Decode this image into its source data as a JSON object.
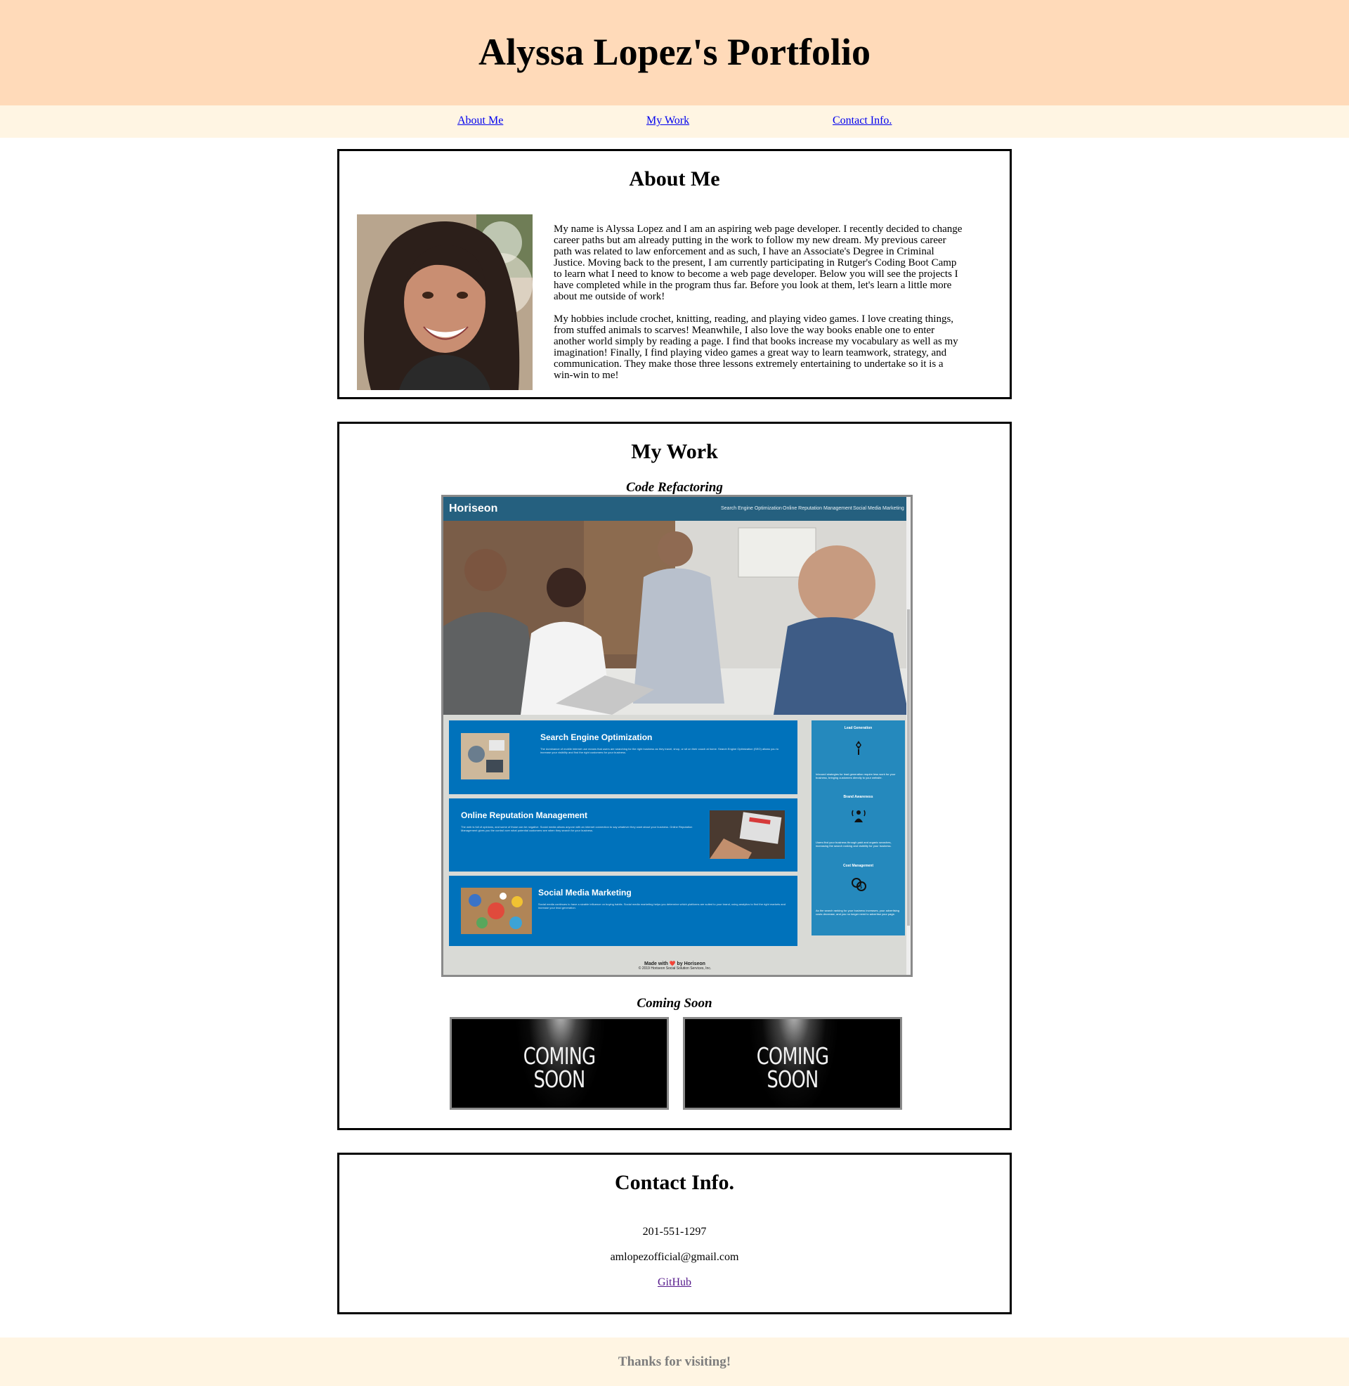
{
  "header": {
    "title": "Alyssa Lopez's Portfolio"
  },
  "nav": {
    "about": "About Me",
    "work": "My Work",
    "contact": "Contact Info."
  },
  "about": {
    "heading": "About Me",
    "paragraphs": [
      "My name is Alyssa Lopez and I am an aspiring web page developer. I recently decided to change career paths but am already putting in the work to follow my new dream. My previous career path was related to law enforcement and as such, I have an Associate's Degree in Criminal Justice. Moving back to the present, I am currently participating in Rutger's Coding Boot Camp to learn what I need to know to become a web page developer. Below you will see the projects I have completed while in the program thus far. Before you look at them, let's learn a little more about me outside of work!",
      "My hobbies include crochet, knitting, reading, and playing video games. I love creating things, from stuffed animals to scarves! Meanwhile, I also love the way books enable one to enter another world simply by reading a page. I find that books increase my vocabulary as well as my imagination! Finally, I find playing video games a great way to learn teamwork, strategy, and communication. They make those three lessons extremely entertaining to undertake so it is a win-win to me!"
    ]
  },
  "work": {
    "heading": "My Work",
    "project1": {
      "title": "Code Refactoring",
      "screenshot": {
        "logo": "Horiseon",
        "nav": [
          "Search Engine Optimization",
          "Online Reputation Management",
          "Social Media Marketing"
        ],
        "services": [
          {
            "title": "Search Engine Optimization",
            "text": "The dominance of mobile internet use means that users are searching for the right business as they travel, shop, or sit on their couch at home. Search Engine Optimization (SEO) allows you to increase your visibility and find the right customers for your business."
          },
          {
            "title": "Online Reputation Management",
            "text": "The web is full of opinions, and some of those can be negative. Social media allows anyone with an internet connection to say whatever they want about your business. Online Reputation Management gives you the control over what potential customers see when they search for your business."
          },
          {
            "title": "Social Media Marketing",
            "text": "Social media continues to have a sizable influence on buying habits. Social media marketing helps you determine which platforms are suited to your brand, using analytics to find the right markets and increase your lead generation."
          }
        ],
        "benefits": [
          {
            "title": "Lead Generation",
            "text": "Inbound strategies for lead generation require less work for your business, bringing customers directly to your website."
          },
          {
            "title": "Brand Awareness",
            "text": "Users find your business through paid and organic searches, increasing the search ranking and visibility for your business."
          },
          {
            "title": "Cost Management",
            "text": "As the search ranking for your business increases, your advertising costs decrease, and you no longer need to advertise your page."
          }
        ],
        "footer_made": "Made with ❤️ by Horiseon",
        "footer_copy": "© 2019 Horiseon Social Solution Services, Inc."
      }
    },
    "coming_soon": {
      "title": "Coming Soon",
      "tiles": [
        {
          "line1": "COMING",
          "line2": "SOON"
        },
        {
          "line1": "COMING",
          "line2": "SOON"
        }
      ]
    }
  },
  "contact": {
    "heading": "Contact Info.",
    "phone": "201-551-1297",
    "email": "amlopezofficial@gmail.com",
    "github": "GitHub"
  },
  "footer": {
    "text": "Thanks for visiting!"
  },
  "colors": {
    "header_bg": "#ffdab9",
    "nav_bg": "#fff5e3",
    "link": "#0000ee",
    "visited_link": "#551a8b",
    "horiseon_bar": "#25607f",
    "horiseon_service": "#0072bb",
    "horiseon_benefits": "#2589bd"
  }
}
